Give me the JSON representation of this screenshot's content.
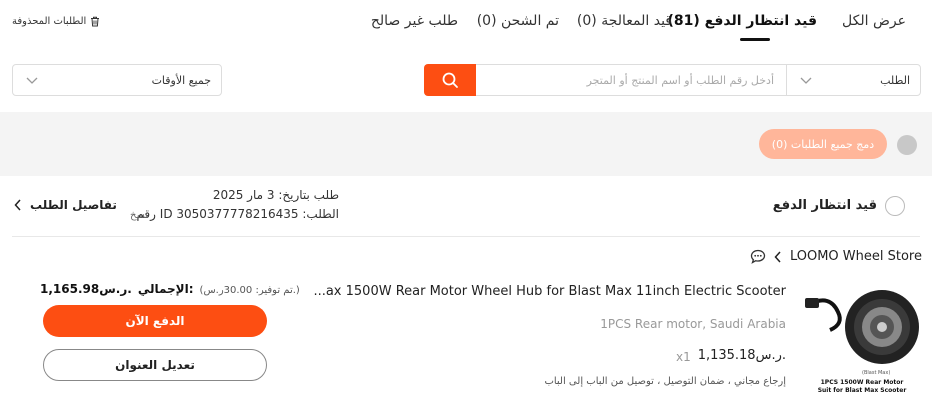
{
  "tabs": [
    {
      "label": "عرض الكل"
    },
    {
      "label": "قيد انتظار الدفع (81)"
    },
    {
      "label": "قيد المعالجة (0)"
    },
    {
      "label": "تم الشحن (0)"
    },
    {
      "label": "طلب غير صالح"
    }
  ],
  "deleted_orders": "الطلبات المحذوفة",
  "search": {
    "type_label": "الطلب",
    "placeholder": "أدخل رقم الطلب أو اسم المنتج أو المتجر",
    "time_filter": "جميع الأوقات"
  },
  "merge_button": "دمج جميع الطلبات (0)",
  "order": {
    "status": "قيد انتظار الدفع",
    "date_label": "طلب بتاريخ: 3 مار 2025",
    "id_label": "رقم ID الطلب: 3050377778216435",
    "copy": "نسخ",
    "details": "تفاصيل الطلب"
  },
  "store": {
    "name": "LOOMO Wheel Store"
  },
  "product": {
    "title": "...ax 1500W Rear Motor Wheel Hub for Blast Max 11inch Electric Scooter",
    "variant": "1PCS Rear motor, Saudi Arabia",
    "price": "1,135.18ر.س.",
    "qty": "x1",
    "services": "إرجاع مجاني ، ضمان التوصيل ، توصيل من الباب إلى الباب",
    "image_caption_1": "1PCS 1500W Rear Motor",
    "image_caption_2": "Suit for Blast Max Scooter",
    "image_label": "(Blast Max)"
  },
  "payment": {
    "saving": "(تم توفير: 30.00ر.س.)",
    "total_label": "الإجمالي:",
    "total_value": "1,165.98ر.س.",
    "pay_now": "الدفع الآن",
    "edit_address": "تعديل العنوان"
  },
  "colors": {
    "accent": "#fd4e12",
    "accent_light": "#ffb69a"
  }
}
